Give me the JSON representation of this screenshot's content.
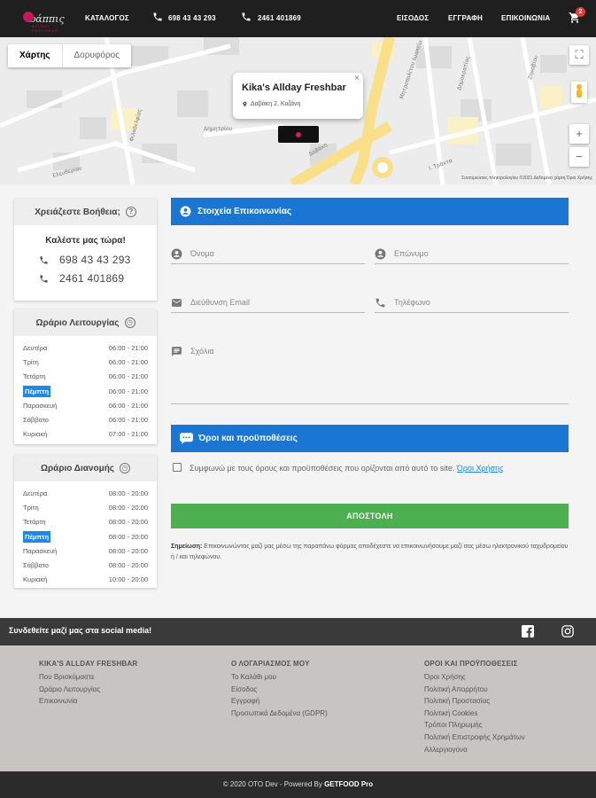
{
  "header": {
    "logo_text": "ωάππις",
    "logo_sub": "ALLDAY FRESHBAR",
    "nav_catalog": "ΚΑΤΑΛΟΓΟΣ",
    "phone1": "698 43 43 293",
    "phone2": "2461 401869",
    "login": "ΕΙΣΟΔΟΣ",
    "register": "ΕΓΓΡΑΦΗ",
    "contact": "ΕΠΙΚΟΙΝΩΝΙΑ",
    "cart_count": "2"
  },
  "map": {
    "tab_map": "Χάρτης",
    "tab_satellite": "Δορυφόρος",
    "info_title": "Kika's Allday Freshbar",
    "info_address": "Δαβάκη 2, Κοζάνη",
    "zoom_in": "+",
    "zoom_out": "−",
    "fullscreen": "⛶",
    "footer_text": "Συντομεύσεις πληκτρολογίου   ©2021 Δεδομένα χάρτη   Όροι Χρήσης",
    "street_labels": [
      "Μητροπολίτου Ιωακείμ",
      "Πρίγκιπος",
      "Φιλαδελφίας",
      "Δαβάκη",
      "Ελευθερίου",
      "Δημοκρατίας",
      "Ζηνοβίου",
      "Δημητρίου",
      "Ι. Τράντα"
    ]
  },
  "help": {
    "title": "Χρειάζεστε Βοήθεια;",
    "call_now": "Καλέστε μας τώρα!",
    "phone1": "698 43 43 293",
    "phone2": "2461 401869"
  },
  "hours": {
    "title": "Ωράριο Λειτουργίας",
    "rows": [
      {
        "day": "Δευτέρα",
        "time": "06:00 - 21:00"
      },
      {
        "day": "Τρίτη",
        "time": "06:00 - 21:00"
      },
      {
        "day": "Τετάρτη",
        "time": "06:00 - 21:00"
      },
      {
        "day": "Πέμπτη",
        "time": "06:00 - 21:00"
      },
      {
        "day": "Παρασκευή",
        "time": "06:00 - 21:00"
      },
      {
        "day": "Σάββατο",
        "time": "06:00 - 21:00"
      },
      {
        "day": "Κυριακή",
        "time": "07:00 - 21:00"
      }
    ]
  },
  "delivery": {
    "title": "Ωράριο Διανομής",
    "rows": [
      {
        "day": "Δευτέρα",
        "time": "08:00 - 20:00"
      },
      {
        "day": "Τρίτη",
        "time": "08:00 - 20:00"
      },
      {
        "day": "Τετάρτη",
        "time": "08:00 - 20:00"
      },
      {
        "day": "Πέμπτη",
        "time": "08:00 - 20:00"
      },
      {
        "day": "Παρασκευή",
        "time": "08:00 - 20:00"
      },
      {
        "day": "Σάββατο",
        "time": "08:00 - 20:00"
      },
      {
        "day": "Κυριακή",
        "time": "10:00 - 20:00"
      }
    ]
  },
  "form": {
    "section_title": "Στοιχεία Επικοινωνίας",
    "first_name": "Όνομα",
    "last_name": "Επώνυμο",
    "email": "Διεύθυνση Email",
    "phone": "Τηλέφωνο",
    "comments": "Σχόλια",
    "terms_title": "Όροι και προϋποθέσεις",
    "terms_text": "Συμφωνώ με τους όρους και προϋποθέσεις που ορίζονται από αυτό το site.",
    "terms_link": "Όροι Χρήσης",
    "submit": "ΑΠΟΣΤΟΛΗ",
    "note_label": "Σημείωση:",
    "note_text": "Επικοινωνώντας μαζί μας μέσω της παραπάνω φόρμας αποδέχεστε να επικοινωνήσουμε μαζί σας μέσω ηλεκτρονικού ταχυδρομείου ή / και τηλεφώνου."
  },
  "social": {
    "title": "Συνδεθείτε μαζί μας στα social media!"
  },
  "footer": {
    "col1_title": "KIKA'S ALLDAY FRESHBAR",
    "col1_links": [
      "Που Βρισκόμαστε",
      "Ωράριο Λειτουργίας",
      "Επικοινωνία"
    ],
    "col2_title": "Ο ΛΟΓΑΡΙΑΣΜΟΣ ΜΟΥ",
    "col2_links": [
      "Το Καλάθι μου",
      "Είσοδος",
      "Εγγραφή",
      "Προσωπικά Δεδομένα (GDPR)"
    ],
    "col3_title": "ΟΡΟΙ ΚΑΙ ΠΡΟΫΠΟΘΕΣΕΙΣ",
    "col3_links": [
      "Όροι Χρήσης",
      "Πολιτική Απορρήτου",
      "Πολιτική Προστασίας",
      "Πολιτική Cookies",
      "Τρόποι Πληρωμής",
      "Πολιτική Επιστροφής Χρημάτων",
      "Αλλεργιογόνα"
    ],
    "copyright_pre": "© 2020 OTO Dev - Powered By",
    "copyright_brand": "GETFOOD Pro"
  },
  "colors": {
    "accent_blue": "#1976d2",
    "submit_green": "#4caf50",
    "brand_pink": "#d81b60"
  }
}
